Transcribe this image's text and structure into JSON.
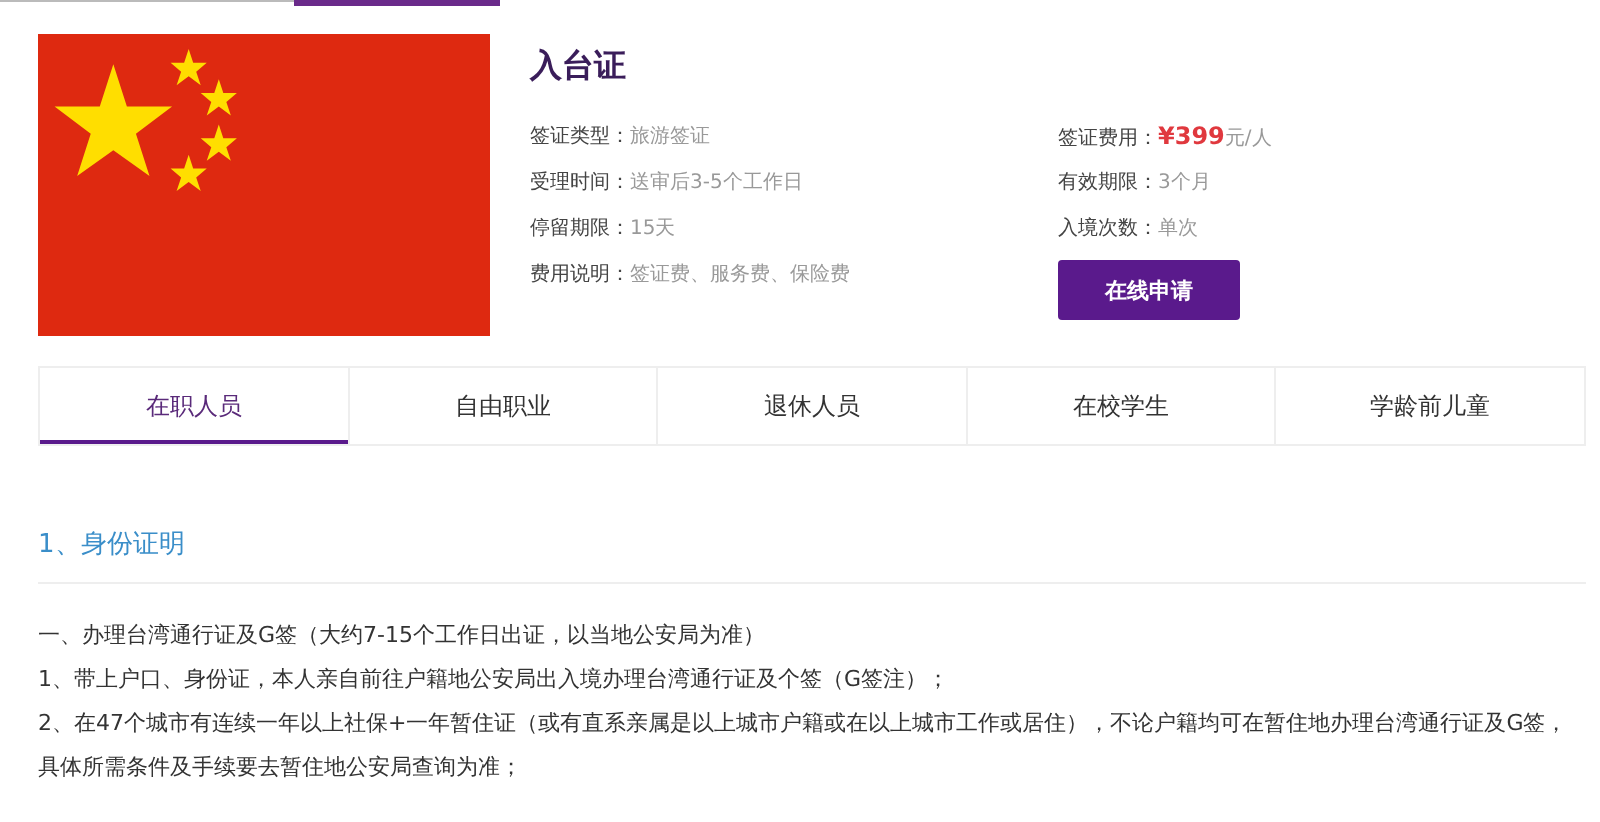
{
  "title": "入台证",
  "details_left": [
    {
      "label": "签证类型：",
      "value": "旅游签证"
    },
    {
      "label": "受理时间：",
      "value": "送审后3-5个工作日"
    },
    {
      "label": "停留期限：",
      "value": "15天"
    },
    {
      "label": "费用说明：",
      "value": "签证费、服务费、保险费"
    }
  ],
  "details_right": [
    {
      "label": "签证费用：",
      "value": "**¥399**元/人",
      "kind": "price"
    },
    {
      "label": "有效期限：",
      "value": "3个月",
      "kind": "plain"
    },
    {
      "label": "入境次数：",
      "value": "单次",
      "kind": "plain"
    }
  ],
  "apply_button": "在线申请",
  "tabs": [
    {
      "label": "在职人员",
      "selected": true
    },
    {
      "label": "自由职业",
      "selected": false
    },
    {
      "label": "退休人员",
      "selected": false
    },
    {
      "label": "在校学生",
      "selected": false
    },
    {
      "label": "学龄前儿童",
      "selected": false
    }
  ],
  "section": {
    "heading": "1、身份证明",
    "paragraphs": [
      "一、办理台湾通行证及G签（大约7-15个工作日出证，以当地公安局为准）",
      "1、带上户口、身份证，本人亲自前往户籍地公安局出入境办理台湾通行证及个签（G签注）；",
      "2、在47个城市有连续一年以上社保+一年暂住证（或有直系亲属是以上城市户籍或在以上城市工作或居住），不论户籍均可在暂住地办理台湾通行证及G签，具体所需条件及手续要去暂住地公安局查询为准；"
    ]
  }
}
